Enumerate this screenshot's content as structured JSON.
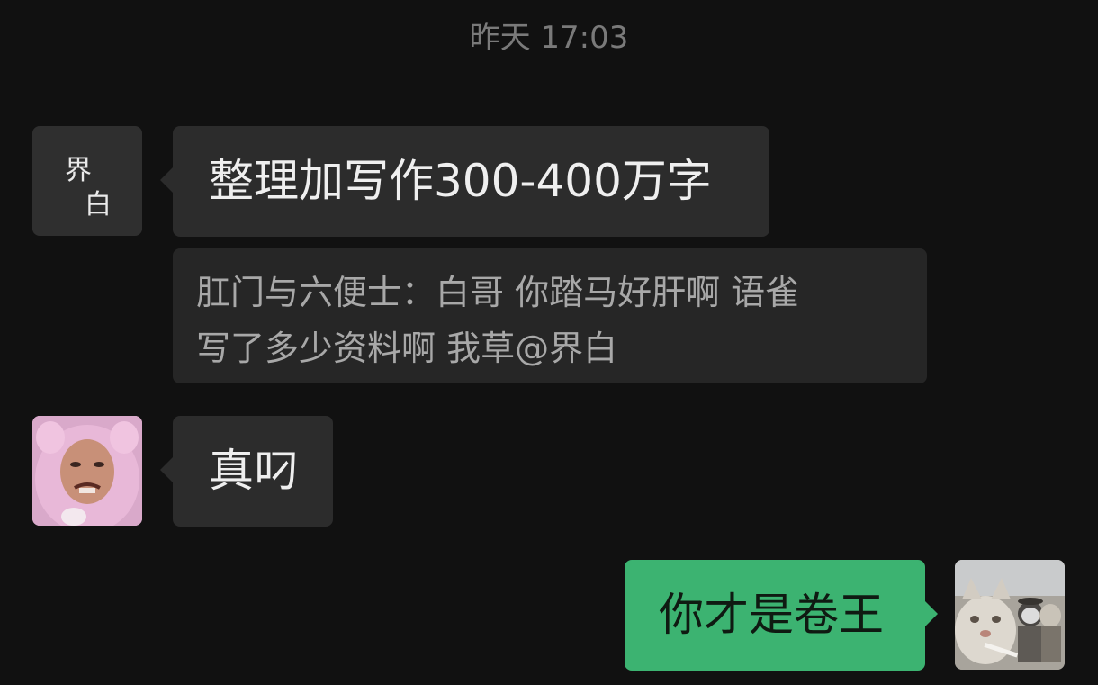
{
  "header": {
    "timestamp": "昨天 17:03"
  },
  "messages": [
    {
      "direction": "incoming",
      "avatar": {
        "type": "calligraphy",
        "chars": [
          "界",
          "白"
        ]
      },
      "text": "整理加写作300-400万字",
      "quote": "肛门与六便士：白哥  你踏马好肝啊 语雀\n写了多少资料啊 我草@界白"
    },
    {
      "direction": "incoming",
      "avatar": {
        "type": "photo",
        "icon": "pink-pig-costume-man-avatar"
      },
      "text": "真叼"
    },
    {
      "direction": "outgoing",
      "avatar": {
        "type": "photo",
        "icon": "cats-gang-avatar"
      },
      "text": "你才是卷王"
    }
  ],
  "colors": {
    "background": "#111111",
    "incoming_bubble": "#2c2c2c",
    "quote_bubble": "#262626",
    "outgoing_bubble": "#3cb371",
    "timestamp_text": "#7a7a7a"
  }
}
